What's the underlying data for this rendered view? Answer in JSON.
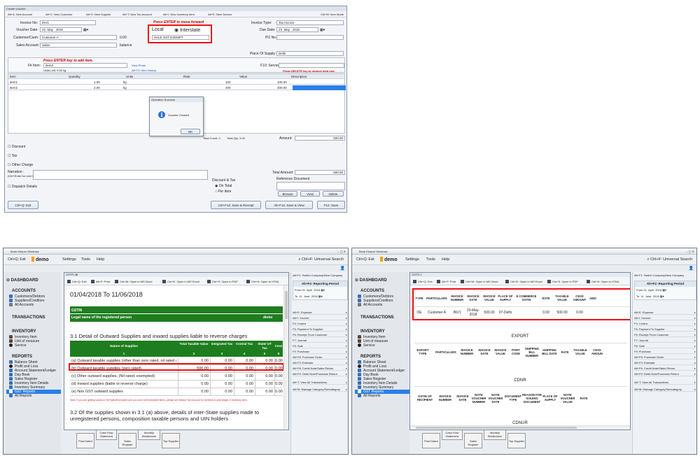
{
  "voucher": {
    "title": "Create Voucher",
    "shortcuts": [
      "Alt+A: New Account",
      "Alt+C: New Customer",
      "Alt+S: New Supplier",
      "Alt+T: New Tax Account",
      "Alt+I: New Inventory Item",
      "Alt+E: New Service"
    ],
    "mode_shortcut": "Ctrl+M: Item Mode",
    "invoice_no_label": "Invoice No:",
    "invoice_no": "INV1",
    "voucher_date_label": "Voucher Date:",
    "date_day": "23",
    "date_month": "May",
    "date_year": "2018",
    "customer_label": "Customer/Cash:",
    "customer": "Customer A",
    "customer_amount": "0.00",
    "sales_account_label": "Sales Account:",
    "sales_account": "Sales",
    "balance_label": "balance",
    "enter_hint": "Press ENTER to move forward",
    "local_label": "Local",
    "interstate_label": "Interstate",
    "gst_type": "SALE GST EXEMPT",
    "invoice_type_label": "Invoice Type:",
    "invoice_type": "Tax Invoice",
    "due_date_label": "Due Date:",
    "due_day": "23",
    "due_month": "May",
    "due_year": "2018",
    "po_label": "PO No.:",
    "place_label": "Place Of Supply:",
    "place": "Delhi",
    "add_item_hint": "Press ENTER key to add item.",
    "fit_item_label": "Fit Item:",
    "fit_item": "item2",
    "units_left": "Units Left: 9.00 kg",
    "view_photo": "View Photo",
    "history": "Alt+F2: Item History",
    "service_label": "F10: Service:",
    "delete_hint": "Press DELETE key to remove item row.",
    "columns": [
      "Item",
      "Quantity",
      "Units",
      "Rate",
      "Value",
      "Description"
    ],
    "rows": [
      {
        "item": "item1",
        "qty": "1.00",
        "units": "kg",
        "rate": "100",
        "value": "100.00"
      },
      {
        "item": "item2",
        "qty": "2.00",
        "units": "kg",
        "rate": "200",
        "value": "400.00"
      }
    ],
    "total_count": "Total Count: 2",
    "total_qty": "Total Qty: 3.00",
    "amount_label": "Amount:",
    "amount": "500.00",
    "discount_label": "Discount",
    "tax_label": "Tax",
    "other_charge_label": "Other Charge",
    "narration_label": "Narration :",
    "narration_hint": "(Ctrl+Enter for next line)",
    "dispatch_label": "Dispatch Details",
    "discount_tax_label": "Discount & Tax",
    "on_total": "On Total",
    "per_item": "Per Item",
    "total_amount_label": "Total Amount:",
    "total_amount": "500.00",
    "reference_label": "Reference Document",
    "browse": "Browse",
    "view": "View",
    "delete": "Delete",
    "exit_btn": "Ctrl+Q: Exit",
    "save_receipt": "Ctrl+F12: Save & Receipt",
    "save_view": "Alt+F12: Save & View",
    "save": "F12: Save",
    "popup": {
      "title": "Operation Success",
      "message": "Voucher Created",
      "ok": "OK"
    }
  },
  "app": {
    "window_title": "Book Keeper Windows",
    "exit": "Ctrl+Q: Exit",
    "brand": "demo",
    "menu": [
      "Settings",
      "Tools",
      "Help"
    ],
    "search": "Ctrl+F: Universal Search",
    "dashboard": "DASHBOARD",
    "accounts": "ACCOUNTS",
    "acc_items": [
      "Customers/Debtors",
      "Suppliers/Creditors",
      "All Accounts"
    ],
    "transactions": "TRANSACTIONS",
    "inventory": "INVENTORY",
    "inv_items": [
      "Inventory Item",
      "Unit of measure",
      "Service"
    ],
    "reports": "REPORTS",
    "rep_items": [
      "Balance Sheet",
      "Profit and Loss",
      "Account Statement/Ledger",
      "Day Book",
      "Sales Register",
      "Inventory Item Details",
      "Inventory Summary",
      "GST Reports",
      "All Reports"
    ],
    "switch_company": "Alt+F1: Switch Company/New Company",
    "period_title": "Alt+F2: Reporting Period",
    "from_label": "From",
    "from_day": "01",
    "from_month": "April",
    "from_year": "2018",
    "to_label": "To",
    "to_day": "11",
    "to_month": "June",
    "to_year": "2018",
    "right_items": [
      "Alt+E: Expense",
      "Alt+I: Income",
      "F4: Contra",
      "F5: Payment To Supplier",
      "F6: Receipt From Customer",
      "F7: Journal",
      "F8: Sale",
      "F9: Purchase",
      "Alt+F8: Purchase Order",
      "Alt+F3: Estimate",
      "Alt+F6: Credit Note/Sales Return",
      "Alt+F9: Debit Note/Purchase Return",
      "Alt+T: View All Transactions",
      "Alt+M: Manage Category/Subcategory"
    ],
    "bottom_tiles": [
      "Post Dated",
      "Cash Flow Statement",
      "Sales Register",
      "Monthly Breakdown",
      "Top Supplier"
    ],
    "panel_title": "GSTR-3B",
    "report_toolbar": [
      "Ctrl+Q: Exit",
      "Alt+P: Print",
      "Ctrl+W: Open In MS Word",
      "Ctrl+E: Open In MS Excel",
      "Ctrl+S: Open In PDF",
      "Ctrl+H: Open In HTML"
    ]
  },
  "gstr3b": {
    "period": "01/04/2018 To 11/06/2018",
    "gstin_label": "GSTIN",
    "legal_name_label": "Legal name of the registered person",
    "legal_name": "demo",
    "section31": "3.1 Detail of Outward Supplies and inward supplies liable to reverse charges",
    "headers": [
      "Nature of Supplies",
      "Total Taxable Value",
      "Integrated Tax",
      "Central Tax",
      "State/ UT Tax",
      "Cess"
    ],
    "numbers": [
      "1",
      "2",
      "3",
      "4",
      "5",
      "6"
    ],
    "rows": [
      {
        "label": "(a) Outward taxable supplies (other than zero rated, nil rated and exempted)",
        "v": [
          "0.00",
          "0.00",
          "0.00",
          "0.00",
          "0.00"
        ]
      },
      {
        "label": "(b) Outward taxable supplies (zero rated)",
        "v": [
          "500.00",
          "0.00",
          "0.00",
          "0.00",
          "0.00"
        ]
      },
      {
        "label": "(c) Other outward supplies, (Nil rated, exempted)",
        "v": [
          "0.00",
          "0.00",
          "0.00",
          "0.00",
          "0.00"
        ]
      },
      {
        "label": "(d) Inward supplies (liable to reverse charge)",
        "v": [
          "0.00",
          "0.00",
          "0.00",
          "0.00",
          "0.00"
        ]
      },
      {
        "label": "(e) Non GST outward supplies",
        "v": [
          "0.00",
          "0.00",
          "0.00",
          "0.00",
          "0.00"
        ]
      }
    ],
    "note": "Note: If you are getting values in Nil Rated/Exempted and you don't sell exempted items, please set Default Tax Account for all items in sale ledger & inventory item.",
    "section32": "3.2 Of the supplies shown in 3.1 (a) above, details of inter-State supplies made to unregistered persons, composition taxable persons and UIN holders"
  },
  "gstr1": {
    "headers": [
      "TYPE",
      "PARTICULARS",
      "INVOICE NUMBER",
      "INVOICE DATE",
      "INVOICE VALUE",
      "PLACE OF SUPPLY",
      "E COMMERCE GSTIN",
      "RATE",
      "TAXABLE VALUE",
      "CESS AMOUNT",
      "AMO"
    ],
    "row": [
      "OE",
      "Customer A",
      "INV1",
      "23-May-2018",
      "500.00",
      "07-Delhi",
      "",
      "0.00",
      "500.00",
      "0.00",
      ""
    ],
    "export_title": "EXPORT",
    "export_headers": [
      "EXPORT TYPE",
      "PARTICULARS",
      "INVOICE NUMBER",
      "INVOICE DATE",
      "INVOICE VALUE",
      "PORT CODE",
      "SHIPPING BILL NUMBER",
      "SHIPPING BILL DATE",
      "RATE",
      "TAXABLE VALUE",
      "CESS AMOUN"
    ],
    "cdnr_title": "CDNR",
    "cdnr_headers": [
      "GSTIN OF RECIPIENT",
      "INVOICE NUMBER",
      "INVOICE DATE",
      "NOTE VOUCHER NUMBER",
      "NOTE VOUCHER DATE",
      "DOCUMENT TYPE",
      "REASON FOR ISSUING DOCUMENT",
      "PLACE OF SUPPLY",
      "NOTE VOUCHER VALUE",
      "RATE"
    ],
    "cdnur_title": "CDNUR"
  },
  "colors": {
    "accent_red": "#e11",
    "gst_green": "#1e7d1e",
    "brand_orange": "#f5a000",
    "highlight_blue": "#2a7fe8"
  }
}
